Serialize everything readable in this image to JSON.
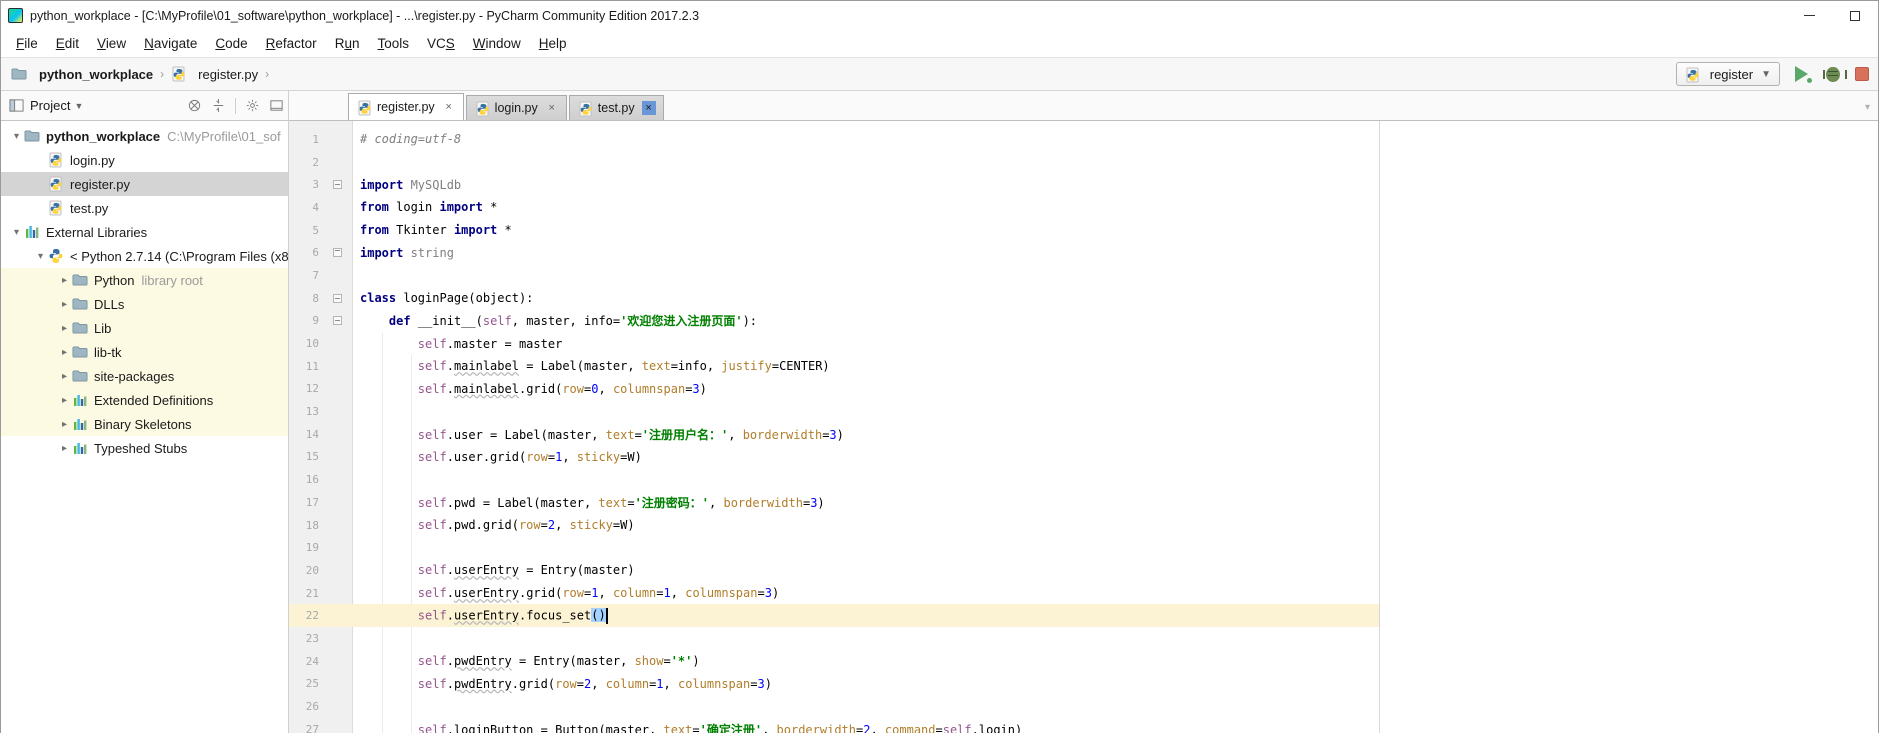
{
  "window": {
    "title": "python_workplace - [C:\\MyProfile\\01_software\\python_workplace] - ...\\register.py - PyCharm Community Edition 2017.2.3",
    "controls": [
      "minimize",
      "maximize"
    ]
  },
  "menu": {
    "items": [
      {
        "label": "File",
        "u": 0
      },
      {
        "label": "Edit",
        "u": 0
      },
      {
        "label": "View",
        "u": 0
      },
      {
        "label": "Navigate",
        "u": 0
      },
      {
        "label": "Code",
        "u": 0
      },
      {
        "label": "Refactor",
        "u": 0
      },
      {
        "label": "Run",
        "u": 1
      },
      {
        "label": "Tools",
        "u": 0
      },
      {
        "label": "VCS",
        "u": 2
      },
      {
        "label": "Window",
        "u": 0
      },
      {
        "label": "Help",
        "u": 0
      }
    ]
  },
  "breadcrumb": {
    "project": "python_workplace",
    "file": "register.py",
    "separator": "›"
  },
  "run_toolbar": {
    "config_label": "register"
  },
  "project_panel": {
    "title": "Project",
    "header_icons": [
      "locate-icon",
      "collapse-all-icon",
      "settings-gear-icon",
      "hide-panel-icon"
    ],
    "tree": [
      {
        "indent": 0,
        "chevron": "down",
        "icon": "folder",
        "label": "python_workplace",
        "bold": true,
        "suffix": "C:\\MyProfile\\01_sof"
      },
      {
        "indent": 1,
        "chevron": null,
        "icon": "py",
        "label": "login.py"
      },
      {
        "indent": 1,
        "chevron": null,
        "icon": "py",
        "label": "register.py",
        "selected": true
      },
      {
        "indent": 1,
        "chevron": null,
        "icon": "py",
        "label": "test.py"
      },
      {
        "indent": 0,
        "chevron": "down",
        "icon": "lib",
        "label": "External Libraries"
      },
      {
        "indent": 1,
        "chevron": "down",
        "icon": "python",
        "label": "< Python 2.7.14 (C:\\Program Files (x8"
      },
      {
        "indent": 2,
        "chevron": "right",
        "icon": "folder",
        "label": "Python",
        "suffix": "library root",
        "yellow": true
      },
      {
        "indent": 2,
        "chevron": "right",
        "icon": "folder",
        "label": "DLLs",
        "yellow": true
      },
      {
        "indent": 2,
        "chevron": "right",
        "icon": "folder",
        "label": "Lib",
        "yellow": true
      },
      {
        "indent": 2,
        "chevron": "right",
        "icon": "folder",
        "label": "lib-tk",
        "yellow": true
      },
      {
        "indent": 2,
        "chevron": "right",
        "icon": "folder",
        "label": "site-packages",
        "yellow": true
      },
      {
        "indent": 2,
        "chevron": "right",
        "icon": "bars",
        "label": "Extended Definitions",
        "yellow": true
      },
      {
        "indent": 2,
        "chevron": "right",
        "icon": "bars",
        "label": "Binary Skeletons",
        "yellow": true
      },
      {
        "indent": 2,
        "chevron": "right",
        "icon": "bars",
        "label": "Typeshed Stubs"
      }
    ]
  },
  "tabs": [
    {
      "label": "register.py",
      "active": true,
      "close": "×"
    },
    {
      "label": "login.py",
      "active": false,
      "close": "×"
    },
    {
      "label": "test.py",
      "active": false,
      "close": "×",
      "blue_close": true
    }
  ],
  "editor": {
    "lines": [
      {
        "n": 1,
        "segs": [
          [
            "# coding=utf-8",
            "com"
          ]
        ]
      },
      {
        "n": 2,
        "segs": []
      },
      {
        "n": 3,
        "fold": "down",
        "segs": [
          [
            "import",
            "kw"
          ],
          [
            " MySQLdb",
            "mod"
          ]
        ]
      },
      {
        "n": 4,
        "segs": [
          [
            "from",
            "kw"
          ],
          [
            " login ",
            "pln"
          ],
          [
            "import",
            "kw"
          ],
          [
            " *",
            "pln"
          ]
        ]
      },
      {
        "n": 5,
        "segs": [
          [
            "from",
            "kw"
          ],
          [
            " Tkinter ",
            "pln"
          ],
          [
            "import",
            "kw"
          ],
          [
            " *",
            "pln"
          ]
        ]
      },
      {
        "n": 6,
        "fold": "up",
        "segs": [
          [
            "import",
            "kw"
          ],
          [
            " string",
            "mod"
          ]
        ]
      },
      {
        "n": 7,
        "segs": []
      },
      {
        "n": 8,
        "fold": "down",
        "segs": [
          [
            "class",
            "kw"
          ],
          [
            " loginPage(object):",
            "pln"
          ]
        ]
      },
      {
        "n": 9,
        "fold": "down",
        "segs": [
          [
            "    ",
            "pln"
          ],
          [
            "def",
            "kw"
          ],
          [
            " __init__(",
            "pln"
          ],
          [
            "self",
            "self"
          ],
          [
            ", master, info=",
            "pln"
          ],
          [
            "'欢迎您进入注册页面'",
            "str"
          ],
          [
            "):",
            "pln"
          ]
        ]
      },
      {
        "n": 10,
        "segs": [
          [
            "        ",
            "pln"
          ],
          [
            "self",
            "self"
          ],
          [
            ".master = master",
            "pln"
          ]
        ]
      },
      {
        "n": 11,
        "segs": [
          [
            "        ",
            "pln"
          ],
          [
            "self",
            "self"
          ],
          [
            ".",
            "pln"
          ],
          [
            "mainlabel",
            "pln sp"
          ],
          [
            " = Label(master, ",
            "pln"
          ],
          [
            "text",
            "arg"
          ],
          [
            "=info, ",
            "pln"
          ],
          [
            "justify",
            "arg"
          ],
          [
            "=CENTER)",
            "pln"
          ]
        ]
      },
      {
        "n": 12,
        "segs": [
          [
            "        ",
            "pln"
          ],
          [
            "self",
            "self"
          ],
          [
            ".",
            "pln"
          ],
          [
            "mainlabel",
            "pln sp"
          ],
          [
            ".grid(",
            "pln"
          ],
          [
            "row",
            "arg"
          ],
          [
            "=",
            "pln"
          ],
          [
            "0",
            "num"
          ],
          [
            ", ",
            "pln"
          ],
          [
            "columnspan",
            "arg"
          ],
          [
            "=",
            "pln"
          ],
          [
            "3",
            "num"
          ],
          [
            ")",
            "pln"
          ]
        ]
      },
      {
        "n": 13,
        "segs": []
      },
      {
        "n": 14,
        "segs": [
          [
            "        ",
            "pln"
          ],
          [
            "self",
            "self"
          ],
          [
            ".user = Label(master, ",
            "pln"
          ],
          [
            "text",
            "arg"
          ],
          [
            "=",
            "pln"
          ],
          [
            "'注册用户名：'",
            "str"
          ],
          [
            ", ",
            "pln"
          ],
          [
            "borderwidth",
            "arg"
          ],
          [
            "=",
            "pln"
          ],
          [
            "3",
            "num"
          ],
          [
            ")",
            "pln"
          ]
        ]
      },
      {
        "n": 15,
        "segs": [
          [
            "        ",
            "pln"
          ],
          [
            "self",
            "self"
          ],
          [
            ".user.grid(",
            "pln"
          ],
          [
            "row",
            "arg"
          ],
          [
            "=",
            "pln"
          ],
          [
            "1",
            "num"
          ],
          [
            ", ",
            "pln"
          ],
          [
            "sticky",
            "arg"
          ],
          [
            "=W)",
            "pln"
          ]
        ]
      },
      {
        "n": 16,
        "segs": []
      },
      {
        "n": 17,
        "segs": [
          [
            "        ",
            "pln"
          ],
          [
            "self",
            "self"
          ],
          [
            ".pwd = Label(master, ",
            "pln"
          ],
          [
            "text",
            "arg"
          ],
          [
            "=",
            "pln"
          ],
          [
            "'注册密码：'",
            "str"
          ],
          [
            ", ",
            "pln"
          ],
          [
            "borderwidth",
            "arg"
          ],
          [
            "=",
            "pln"
          ],
          [
            "3",
            "num"
          ],
          [
            ")",
            "pln"
          ]
        ]
      },
      {
        "n": 18,
        "segs": [
          [
            "        ",
            "pln"
          ],
          [
            "self",
            "self"
          ],
          [
            ".pwd.grid(",
            "pln"
          ],
          [
            "row",
            "arg"
          ],
          [
            "=",
            "pln"
          ],
          [
            "2",
            "num"
          ],
          [
            ", ",
            "pln"
          ],
          [
            "sticky",
            "arg"
          ],
          [
            "=W)",
            "pln"
          ]
        ]
      },
      {
        "n": 19,
        "segs": []
      },
      {
        "n": 20,
        "segs": [
          [
            "        ",
            "pln"
          ],
          [
            "self",
            "self"
          ],
          [
            ".",
            "pln"
          ],
          [
            "userEntry",
            "pln sp"
          ],
          [
            " = Entry(master)",
            "pln"
          ]
        ]
      },
      {
        "n": 21,
        "segs": [
          [
            "        ",
            "pln"
          ],
          [
            "self",
            "self"
          ],
          [
            ".",
            "pln"
          ],
          [
            "userEntry",
            "pln sp"
          ],
          [
            ".grid(",
            "pln"
          ],
          [
            "row",
            "arg"
          ],
          [
            "=",
            "pln"
          ],
          [
            "1",
            "num"
          ],
          [
            ", ",
            "pln"
          ],
          [
            "column",
            "arg"
          ],
          [
            "=",
            "pln"
          ],
          [
            "1",
            "num"
          ],
          [
            ", ",
            "pln"
          ],
          [
            "columnspan",
            "arg"
          ],
          [
            "=",
            "pln"
          ],
          [
            "3",
            "num"
          ],
          [
            ")",
            "pln"
          ]
        ]
      },
      {
        "n": 22,
        "current": true,
        "caret": true,
        "segs": [
          [
            "        ",
            "pln"
          ],
          [
            "self",
            "self"
          ],
          [
            ".",
            "pln"
          ],
          [
            "userEntry",
            "pln sp"
          ],
          [
            ".focus_set",
            "pln"
          ],
          [
            "()",
            "pln hl"
          ]
        ]
      },
      {
        "n": 23,
        "segs": []
      },
      {
        "n": 24,
        "segs": [
          [
            "        ",
            "pln"
          ],
          [
            "self",
            "self"
          ],
          [
            ".",
            "pln"
          ],
          [
            "pwdEntry",
            "pln sp"
          ],
          [
            " = Entry(master, ",
            "pln"
          ],
          [
            "show",
            "arg"
          ],
          [
            "=",
            "pln"
          ],
          [
            "'*'",
            "str"
          ],
          [
            ")",
            "pln"
          ]
        ]
      },
      {
        "n": 25,
        "segs": [
          [
            "        ",
            "pln"
          ],
          [
            "self",
            "self"
          ],
          [
            ".",
            "pln"
          ],
          [
            "pwdEntry",
            "pln sp"
          ],
          [
            ".grid(",
            "pln"
          ],
          [
            "row",
            "arg"
          ],
          [
            "=",
            "pln"
          ],
          [
            "2",
            "num"
          ],
          [
            ", ",
            "pln"
          ],
          [
            "column",
            "arg"
          ],
          [
            "=",
            "pln"
          ],
          [
            "1",
            "num"
          ],
          [
            ", ",
            "pln"
          ],
          [
            "columnspan",
            "arg"
          ],
          [
            "=",
            "pln"
          ],
          [
            "3",
            "num"
          ],
          [
            ")",
            "pln"
          ]
        ]
      },
      {
        "n": 26,
        "segs": []
      },
      {
        "n": 27,
        "segs": [
          [
            "        ",
            "pln"
          ],
          [
            "self",
            "self"
          ],
          [
            ".",
            "pln"
          ],
          [
            "loginButton",
            "pln sp"
          ],
          [
            " = Button(master, ",
            "pln"
          ],
          [
            "text",
            "arg"
          ],
          [
            "=",
            "pln"
          ],
          [
            "'确定注册'",
            "str"
          ],
          [
            ", ",
            "pln"
          ],
          [
            "borderwidth",
            "arg"
          ],
          [
            "=",
            "pln"
          ],
          [
            "2",
            "num"
          ],
          [
            ", ",
            "pln"
          ],
          [
            "command",
            "arg"
          ],
          [
            "=",
            "pln"
          ],
          [
            "self",
            "self"
          ],
          [
            ".login)",
            "pln"
          ]
        ]
      }
    ]
  },
  "colors": {
    "keyword": "#000080",
    "string": "#008000",
    "number": "#0000ff",
    "comment": "#808080",
    "self": "#94558d",
    "keyword_arg": "#b07e2b",
    "current_line": "#fbf3d3",
    "tree_library_bg": "#fcfae3",
    "tree_selection_bg": "#d4d4d4",
    "run_green": "#59a869",
    "stop_red": "#d8705c",
    "paren_match_bg": "#a6d2ff"
  }
}
